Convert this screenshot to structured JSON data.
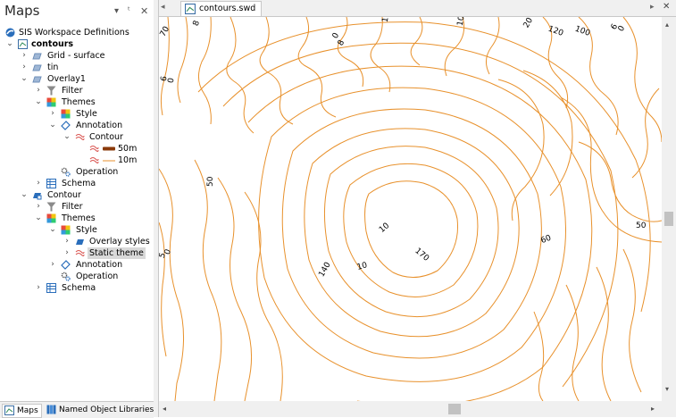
{
  "panel": {
    "title": "Maps"
  },
  "tree": {
    "root": "SIS Workspace Definitions",
    "contours": "contours",
    "grid_surface": "Grid - surface",
    "tin": "tin",
    "overlay1": "Overlay1",
    "filter1": "Filter",
    "themes1": "Themes",
    "style1": "Style",
    "annotation1": "Annotation",
    "contour_item": "Contour",
    "legend_50m": "50m",
    "legend_10m": "10m",
    "operation1": "Operation",
    "schema1": "Schema",
    "contour_overlay": "Contour",
    "filter2": "Filter",
    "themes2": "Themes",
    "style2": "Style",
    "overlay_styles": "Overlay styles",
    "static_theme": "Static theme",
    "annotation2": "Annotation",
    "operation2": "Operation",
    "schema2": "Schema"
  },
  "bottom_tabs": {
    "maps": "Maps",
    "named_object_libraries": "Named Object Libraries"
  },
  "document": {
    "tab_title": "contours.swd"
  },
  "map_labels": [
    "70",
    "8",
    "0",
    "8",
    "6",
    "0",
    "10",
    "10",
    "20",
    "120",
    "100",
    "6",
    "0",
    "50",
    "10",
    "170",
    "140",
    "10",
    "60",
    "50",
    "5",
    "0"
  ],
  "colors": {
    "contour": "#e8912c",
    "selection": "#d9d9d9",
    "bold_contour": "#8a3a0a"
  }
}
